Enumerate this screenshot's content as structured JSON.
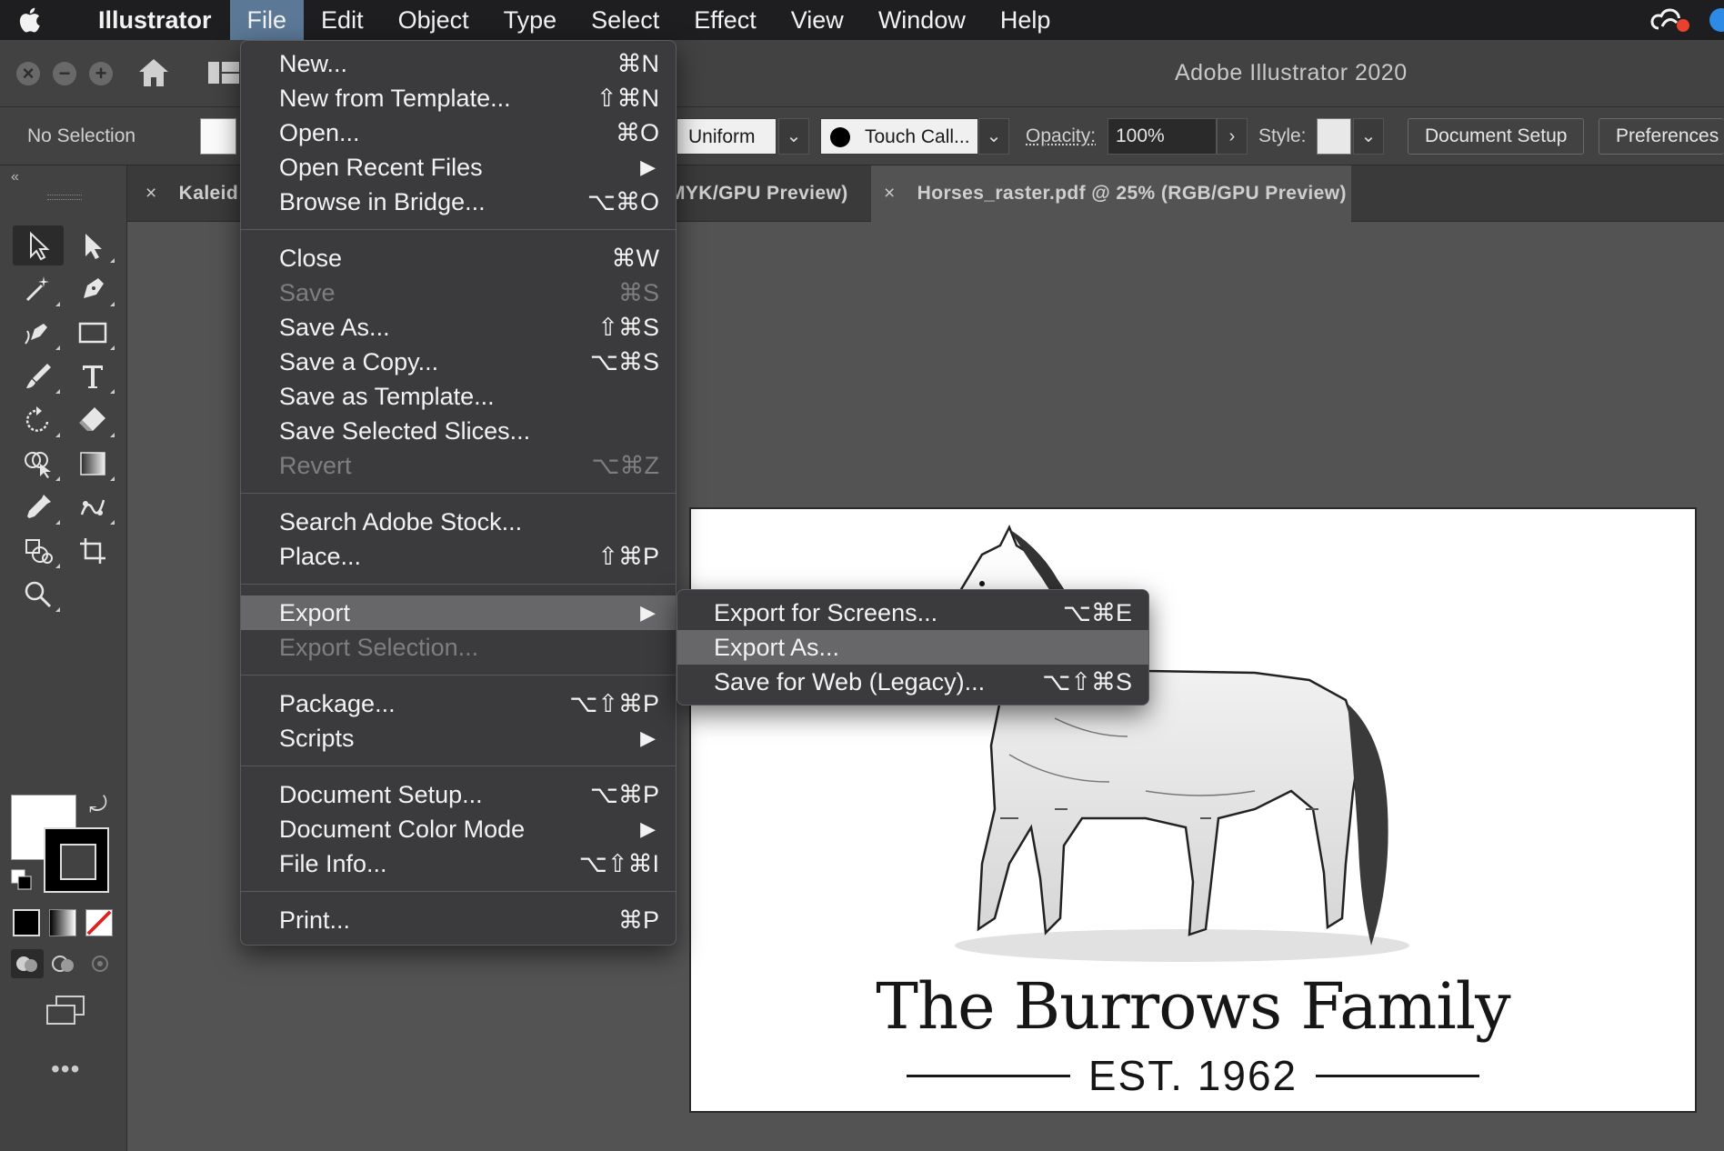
{
  "menubar": {
    "app_name": "Illustrator",
    "items": [
      "File",
      "Edit",
      "Object",
      "Type",
      "Select",
      "Effect",
      "View",
      "Window",
      "Help"
    ]
  },
  "titlebar": {
    "title": "Adobe Illustrator 2020"
  },
  "controlbar": {
    "selection_status": "No Selection",
    "stroke_profile": "Uniform",
    "brush": "Touch Call...",
    "opacity_label": "Opacity:",
    "opacity_value": "100%",
    "style_label": "Style:",
    "document_setup": "Document Setup",
    "preferences": "Preferences"
  },
  "doc_tabs": [
    {
      "label": "Kaleid",
      "active": false
    },
    {
      "label": "MYK/GPU Preview)",
      "active": false
    },
    {
      "label": "Horses_raster.pdf @ 25% (RGB/GPU Preview)",
      "active": true
    }
  ],
  "artboard": {
    "title": "The Burrows Family",
    "subtitle": "EST. 1962"
  },
  "file_menu": {
    "groups": [
      [
        {
          "label": "New...",
          "shortcut": "⌘N"
        },
        {
          "label": "New from Template...",
          "shortcut": "⇧⌘N"
        },
        {
          "label": "Open...",
          "shortcut": "⌘O"
        },
        {
          "label": "Open Recent Files",
          "submenu": "▶"
        },
        {
          "label": "Browse in Bridge...",
          "shortcut": "⌥⌘O"
        }
      ],
      [
        {
          "label": "Close",
          "shortcut": "⌘W"
        },
        {
          "label": "Save",
          "shortcut": "⌘S",
          "disabled": true
        },
        {
          "label": "Save As...",
          "shortcut": "⇧⌘S"
        },
        {
          "label": "Save a Copy...",
          "shortcut": "⌥⌘S"
        },
        {
          "label": "Save as Template..."
        },
        {
          "label": "Save Selected Slices..."
        },
        {
          "label": "Revert",
          "shortcut": "⌥⌘Z",
          "disabled": true
        }
      ],
      [
        {
          "label": "Search Adobe Stock..."
        },
        {
          "label": "Place...",
          "shortcut": "⇧⌘P"
        }
      ],
      [
        {
          "label": "Export",
          "submenu": "▶",
          "highlight": true
        },
        {
          "label": "Export Selection...",
          "disabled": true
        }
      ],
      [
        {
          "label": "Package...",
          "shortcut": "⌥⇧⌘P"
        },
        {
          "label": "Scripts",
          "submenu": "▶"
        }
      ],
      [
        {
          "label": "Document Setup...",
          "shortcut": "⌥⌘P"
        },
        {
          "label": "Document Color Mode",
          "submenu": "▶"
        },
        {
          "label": "File Info...",
          "shortcut": "⌥⇧⌘I"
        }
      ],
      [
        {
          "label": "Print...",
          "shortcut": "⌘P"
        }
      ]
    ]
  },
  "export_menu": {
    "items": [
      {
        "label": "Export for Screens...",
        "shortcut": "⌥⌘E"
      },
      {
        "label": "Export As...",
        "highlight": true
      },
      {
        "label": "Save for Web (Legacy)...",
        "shortcut": "⌥⇧⌘S"
      }
    ]
  },
  "colors": {
    "menubar_bg": "#1e1e20",
    "menu_active": "#5b7896",
    "menu_bg": "#3b3b3d",
    "menu_highlight": "#67676a",
    "canvas_bg": "#535353"
  }
}
